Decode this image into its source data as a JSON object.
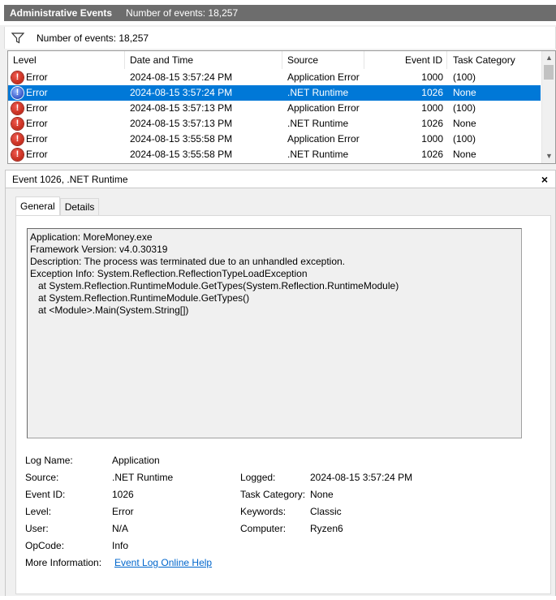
{
  "titlebar": {
    "title": "Administrative Events",
    "count": "Number of events: 18,257"
  },
  "filterbar": {
    "icon": "filter-icon",
    "text": "Number of events: 18,257"
  },
  "events": {
    "columns": {
      "level": "Level",
      "date": "Date and Time",
      "source": "Source",
      "event_id": "Event ID",
      "task": "Task Category"
    },
    "rows": [
      {
        "level": "Error",
        "date": "2024-08-15 3:57:24 PM",
        "source": "Application Error",
        "event_id": "1000",
        "task": "(100)"
      },
      {
        "level": "Error",
        "date": "2024-08-15 3:57:24 PM",
        "source": ".NET Runtime",
        "event_id": "1026",
        "task": "None"
      },
      {
        "level": "Error",
        "date": "2024-08-15 3:57:13 PM",
        "source": "Application Error",
        "event_id": "1000",
        "task": "(100)"
      },
      {
        "level": "Error",
        "date": "2024-08-15 3:57:13 PM",
        "source": ".NET Runtime",
        "event_id": "1026",
        "task": "None"
      },
      {
        "level": "Error",
        "date": "2024-08-15 3:55:58 PM",
        "source": "Application Error",
        "event_id": "1000",
        "task": "(100)"
      },
      {
        "level": "Error",
        "date": "2024-08-15 3:55:58 PM",
        "source": ".NET Runtime",
        "event_id": "1026",
        "task": "None"
      }
    ],
    "selected_index": 1
  },
  "detail": {
    "title": "Event 1026, .NET Runtime",
    "close_glyph": "×",
    "tabs": [
      "General",
      "Details"
    ],
    "description": [
      "Application: MoreMoney.exe",
      "Framework Version: v4.0.30319",
      "Description: The process was terminated due to an unhandled exception.",
      "Exception Info: System.Reflection.ReflectionTypeLoadException",
      "   at System.Reflection.RuntimeModule.GetTypes(System.Reflection.RuntimeModule)",
      "   at System.Reflection.RuntimeModule.GetTypes()",
      "   at <Module>.Main(System.String[])"
    ],
    "props": {
      "log_name_label": "Log Name:",
      "log_name": "Application",
      "source_label": "Source:",
      "source": ".NET Runtime",
      "logged_label": "Logged:",
      "logged": "2024-08-15 3:57:24 PM",
      "event_id_label": "Event ID:",
      "event_id": "1026",
      "task_label": "Task Category:",
      "task": "None",
      "level_label": "Level:",
      "level": "Error",
      "keywords_label": "Keywords:",
      "keywords": "Classic",
      "user_label": "User:",
      "user": "N/A",
      "computer_label": "Computer:",
      "computer": "Ryzen6",
      "opcode_label": "OpCode:",
      "opcode": "Info",
      "more_info_label": "More Information:",
      "more_info_link": "Event Log Online Help"
    }
  }
}
